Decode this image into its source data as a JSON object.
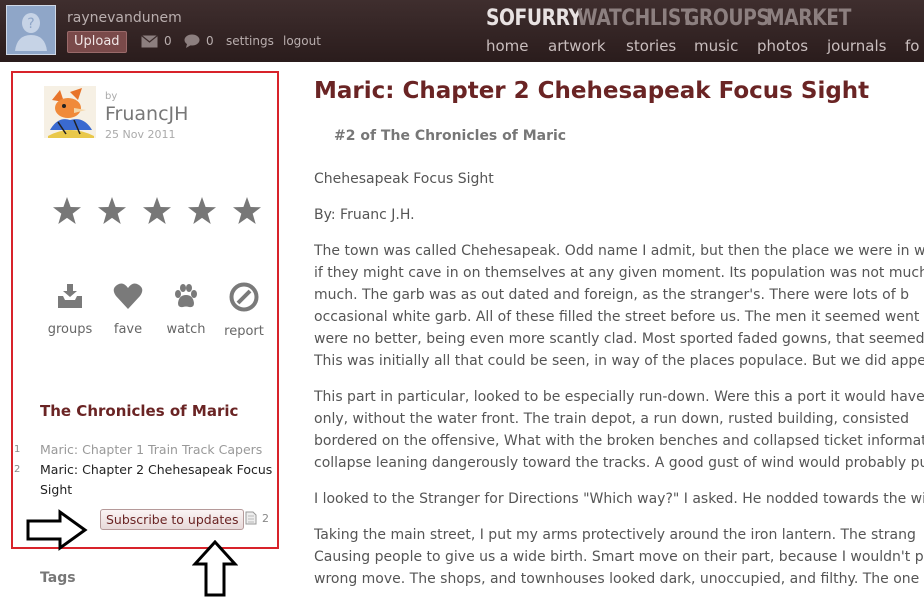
{
  "topbar": {
    "username": "raynevandunem",
    "upload_label": "Upload",
    "messages_count": "0",
    "comments_count": "0",
    "settings_label": "settings",
    "logout_label": "logout",
    "main_nav": [
      "SOFURRY",
      "WATCHLIST",
      "GROUPS",
      "MARKET"
    ],
    "sub_nav": [
      "home",
      "artwork",
      "stories",
      "music",
      "photos",
      "journals",
      "fo"
    ]
  },
  "sidebar": {
    "by_label": "by",
    "author": "FruancJH",
    "date": "25 Nov 2011",
    "rating_stars": 5,
    "actions": [
      "groups",
      "fave",
      "watch",
      "report"
    ],
    "folder_title": "The Chronicles of Maric",
    "folder_items": [
      {
        "num": "1",
        "text": "Maric: Chapter 1 Train Track Capers"
      },
      {
        "num": "2",
        "text": "Maric: Chapter 2 Chehesapeak Focus",
        "text2": "Sight"
      }
    ],
    "subscribe_label": "Subscribe to updates",
    "subscribe_count": "2",
    "tags_title": "Tags"
  },
  "main": {
    "title": "Maric: Chapter 2 Chehesapeak Focus Sight",
    "series": "#2 of The Chronicles of Maric",
    "paragraphs": [
      [
        "Chehesapeak Focus Sight"
      ],
      [
        "By: Fruanc J.H."
      ],
      [
        "The town was called Chehesapeak. Odd name I admit, but then the place we were in was u",
        "if they might cave in on themselves at any given moment. Its population was not much b",
        "much. The garb was as out dated and foreign, as the stranger's. There were lots of b",
        "occasional white garb. All of these filled the street before us. The men it seemed went",
        "were no better, being even more scantly clad. Most sported faded gowns, that seemed to",
        "This was initially all that could be seen, in way of the places populace. But we did appear t"
      ],
      [
        "This part in particular, looked to be especially run-down. Were this a port it would have b",
        "only, without the water front. The train depot, a run down, rusted building, consisted",
        "bordered on the offensive, What with the broken benches and collapsed ticket informatio",
        "collapse leaning dangerously toward the tracks. A good gust of wind would probably push it"
      ],
      [
        "I looked to the Stranger for Directions \"Which way?\" I asked. He nodded towards the wides"
      ],
      [
        "Taking the main street, I put my arms protectively around the iron lantern. The strang",
        "Causing people to give us a wide birth. Smart move on their part, because I wouldn't put",
        "wrong move. The shops, and townhouses looked dark, unoccupied, and filthy. The one on"
      ]
    ]
  }
}
